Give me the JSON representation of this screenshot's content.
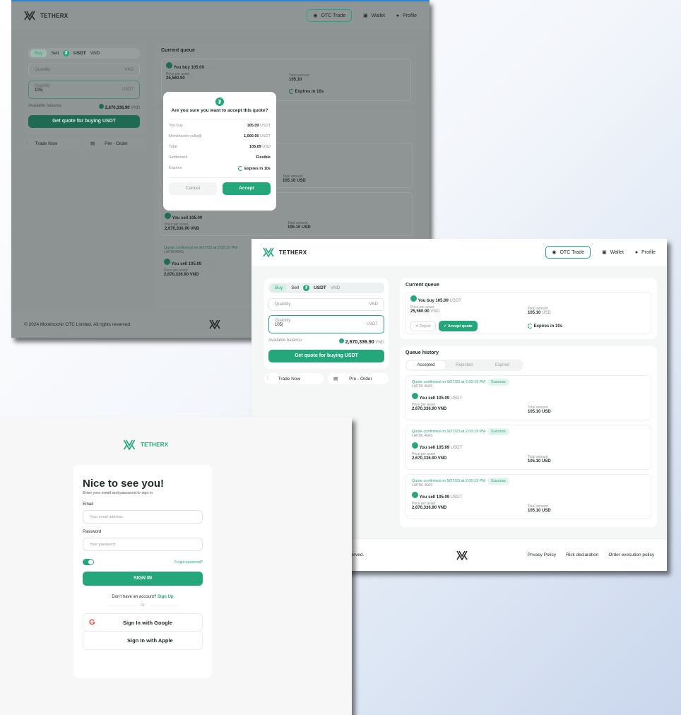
{
  "brand": "TETHERX",
  "nav": {
    "otc": "OTC Trade",
    "wallet": "Wallet",
    "profile": "Profile"
  },
  "trade": {
    "buy": "Buy",
    "sell": "Sell",
    "asset": "USDT",
    "fiat": "VND",
    "quantity": "Quantity",
    "quantity_unit": "VND",
    "quantity2_label": "Quantity",
    "quantity2_value": "105|",
    "quantity2_unit": "USDT",
    "balance_label": "Available balance",
    "balance_value": "2,670,336.90",
    "balance_unit": "VND",
    "quote_button": "Get quote for buying USDT",
    "trade_now": "Trade Now",
    "preorder": "Pre - Order"
  },
  "queue": {
    "title": "Current queue",
    "you_buy": "You buy 105.09",
    "you_buy_unit": "USDT",
    "price_label": "Price per asset",
    "price_value": "25,560.90",
    "price_unit": "VND",
    "total_label": "Total amount",
    "total_value": "105.10",
    "total_unit": "USD",
    "reject": "Reject",
    "accept": "Accept quote",
    "expires": "Expires in 10s"
  },
  "history": {
    "title": "Queue history",
    "tabs": [
      "Accepted",
      "Rejected",
      "Expired"
    ],
    "rows": [
      {
        "confirmed": "Quote confirmed on 9/27/23 at 2:00:19 PM",
        "status": "Success",
        "id": "LAPD6 46AS",
        "sell": "You sell 105.09",
        "sell_unit": "USDT",
        "price_label": "Price per asset",
        "price": "2,670,336.90 VND",
        "total_label": "Total amount",
        "total": "105.10 USD"
      },
      {
        "confirmed": "Quote confirmed on 9/27/23 at 2:00:19 PM",
        "status": "Success",
        "id": "LAPD6 46AS",
        "sell": "You sell 105.09",
        "sell_unit": "USDT",
        "price_label": "Price per asset",
        "price": "2,670,336.90 VND",
        "total_label": "Total amount",
        "total": "105.10 USD"
      },
      {
        "confirmed": "Quote confirmed on 9/27/23 at 2:00:19 PM",
        "status": "Success",
        "id": "LAPD6 46AS",
        "sell": "You sell 105.09",
        "sell_unit": "USDT",
        "price_label": "Price per asset",
        "price": "2,670,336.90 VND",
        "total_label": "Total amount",
        "total": "105.10 USD"
      }
    ]
  },
  "modal": {
    "title": "Are you sure you want to accept this quote?",
    "rows": [
      {
        "label": "You buy",
        "value": "105.09",
        "unit": "USDT"
      },
      {
        "label": "Monkhochir sells@",
        "value": "1,000.00",
        "unit": "USDT"
      },
      {
        "label": "Total",
        "value": "105.09",
        "unit": "USD"
      },
      {
        "label": "Settlement",
        "value": "Flexible",
        "unit": ""
      },
      {
        "label": "Expires",
        "value": "Expires in 10s",
        "unit": ""
      }
    ],
    "cancel": "Cancel",
    "accept": "Accept"
  },
  "footer": {
    "copyright": "© 2024 Monkhochir OTC Limited. All rights reserved.",
    "partial": "served.",
    "links": [
      "Privacy Policy",
      "Risk declaration",
      "Order execution policy"
    ]
  },
  "login": {
    "title": "Nice to see you!",
    "subtitle": "Enter your email and password to sign in",
    "email_label": "Email",
    "email_placeholder": "Your email address",
    "password_label": "Password",
    "password_placeholder": "Your password",
    "forgot": "Forgot password?",
    "signin": "SIGN IN",
    "no_account": "Don't have an account?",
    "signup": "Sign Up",
    "or": "Or",
    "google": "Sign In with Google",
    "apple": "Sign In with Apple"
  }
}
